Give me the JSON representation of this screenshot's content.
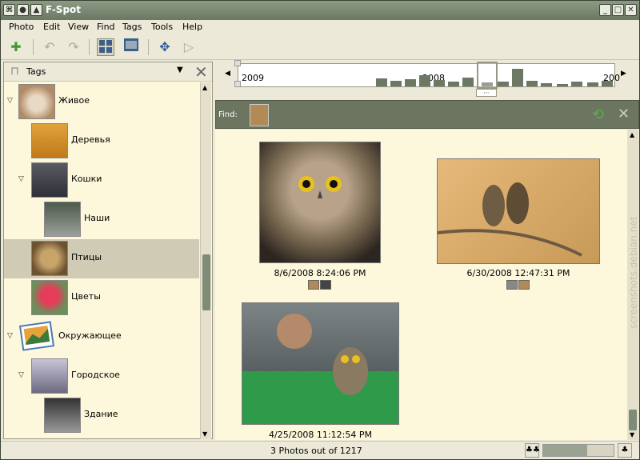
{
  "window": {
    "title": "F-Spot"
  },
  "menu": [
    "Photo",
    "Edit",
    "View",
    "Find",
    "Tags",
    "Tools",
    "Help"
  ],
  "left_panel": {
    "selector_label": "Tags",
    "tags": [
      {
        "label": "Живое",
        "indent": 0,
        "expanded": true,
        "thumb": "fox"
      },
      {
        "label": "Деревья",
        "indent": 1,
        "expanded": null,
        "thumb": "tree"
      },
      {
        "label": "Кошки",
        "indent": 1,
        "expanded": true,
        "thumb": "cat"
      },
      {
        "label": "Наши",
        "indent": 2,
        "expanded": null,
        "thumb": "cat2"
      },
      {
        "label": "Птицы",
        "indent": 1,
        "expanded": null,
        "thumb": "owl",
        "selected": true
      },
      {
        "label": "Цветы",
        "indent": 1,
        "expanded": null,
        "thumb": "flower"
      },
      {
        "label": "Окружающее",
        "indent": 0,
        "expanded": true,
        "thumb": "landscape"
      },
      {
        "label": "Городское",
        "indent": 1,
        "expanded": true,
        "thumb": "city"
      },
      {
        "label": "Здание",
        "indent": 2,
        "expanded": null,
        "thumb": "building"
      }
    ]
  },
  "timeline": {
    "years": [
      "2009",
      "2008",
      "200"
    ]
  },
  "find": {
    "label": "Find:"
  },
  "photos": [
    {
      "caption": "8/6/2008 8:24:06 PM"
    },
    {
      "caption": "6/30/2008 12:47:31 PM"
    },
    {
      "caption": "4/25/2008 11:12:54 PM"
    }
  ],
  "status": {
    "text": "3 Photos out of 1217"
  },
  "zoom": {
    "level": 0.62
  },
  "watermark": "screenshots.debian.net",
  "colors": {
    "accent": "#6b7864",
    "panel_bg": "#fdf8dc",
    "selected_row": "#cfcbb4"
  }
}
